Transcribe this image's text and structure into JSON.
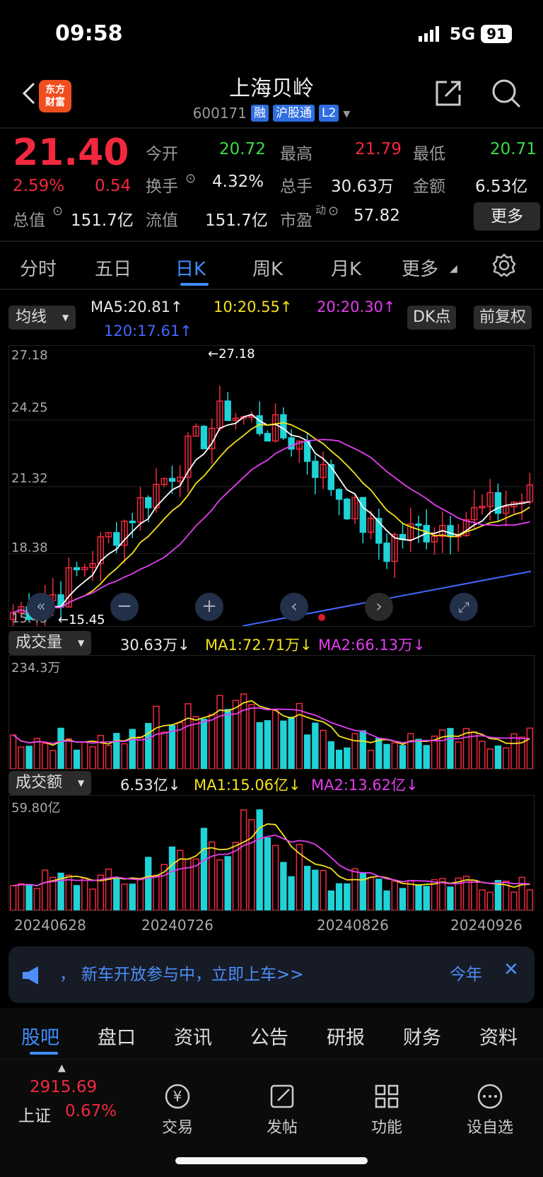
{
  "status": {
    "time": "09:58",
    "network": "5G",
    "battery": "91"
  },
  "header": {
    "title": "上海贝岭",
    "code": "600171",
    "tags": [
      "融",
      "沪股通",
      "L2"
    ],
    "logo_line1": "东方",
    "logo_line2": "财富"
  },
  "quote": {
    "price": "21.40",
    "pct": "2.59%",
    "chg": "0.54",
    "open_label": "今开",
    "open": "20.72",
    "high_label": "最高",
    "high": "21.79",
    "low_label": "最低",
    "low": "20.71",
    "turnover_label": "换手",
    "turnover": "4.32%",
    "volume_label": "总手",
    "volume": "30.63万",
    "amount_label": "金额",
    "amount": "6.53亿",
    "mktcap_label": "总值",
    "mktcap": "151.7亿",
    "float_label": "流值",
    "float": "151.7亿",
    "pe_label": "市盈",
    "pe_sup": "动",
    "pe": "57.82",
    "more": "更多"
  },
  "tabs": [
    "分时",
    "五日",
    "日K",
    "周K",
    "月K",
    "更多"
  ],
  "kline": {
    "selector": "均线",
    "ma5": "MA5:20.81↑",
    "ma10": "10:20.55↑",
    "ma20": "20:20.30↑",
    "ma120": "120:17.61↑",
    "dk_btn": "DK点",
    "adjust_btn": "前复权",
    "y_labels": [
      "27.18",
      "24.25",
      "21.32",
      "18.38",
      "15.45"
    ],
    "max_annot": "←27.18",
    "min_annot": "←15.45",
    "colors": {
      "up": "#f0293e",
      "down": "#1fd3d8",
      "ma5": "#ffffff",
      "ma10": "#f4e21b",
      "ma20": "#e33ef1",
      "ma120": "#4467ff"
    }
  },
  "volume": {
    "selector": "成交量",
    "value": "30.63万↓",
    "ma1": "MA1:72.71万↓",
    "ma2": "MA2:66.13万↓",
    "max_label": "234.3万"
  },
  "amount": {
    "selector": "成交额",
    "value": "6.53亿↓",
    "ma1": "MA1:15.06亿↓",
    "ma2": "MA2:13.62亿↓",
    "max_label": "59.80亿"
  },
  "dates": [
    "20240628",
    "20240726",
    "20240826",
    "20240926"
  ],
  "banner": {
    "text": "新车开放参与中，立即上车>>",
    "prefix": "，",
    "right": "今年"
  },
  "bottom_tabs": [
    "股吧",
    "盘口",
    "资讯",
    "公告",
    "研报",
    "财务",
    "资料"
  ],
  "footer": {
    "index_value": "2915.69",
    "index_name": "上证",
    "index_pct": "0.67%",
    "items": [
      "交易",
      "发帖",
      "功能",
      "设自选"
    ]
  }
}
